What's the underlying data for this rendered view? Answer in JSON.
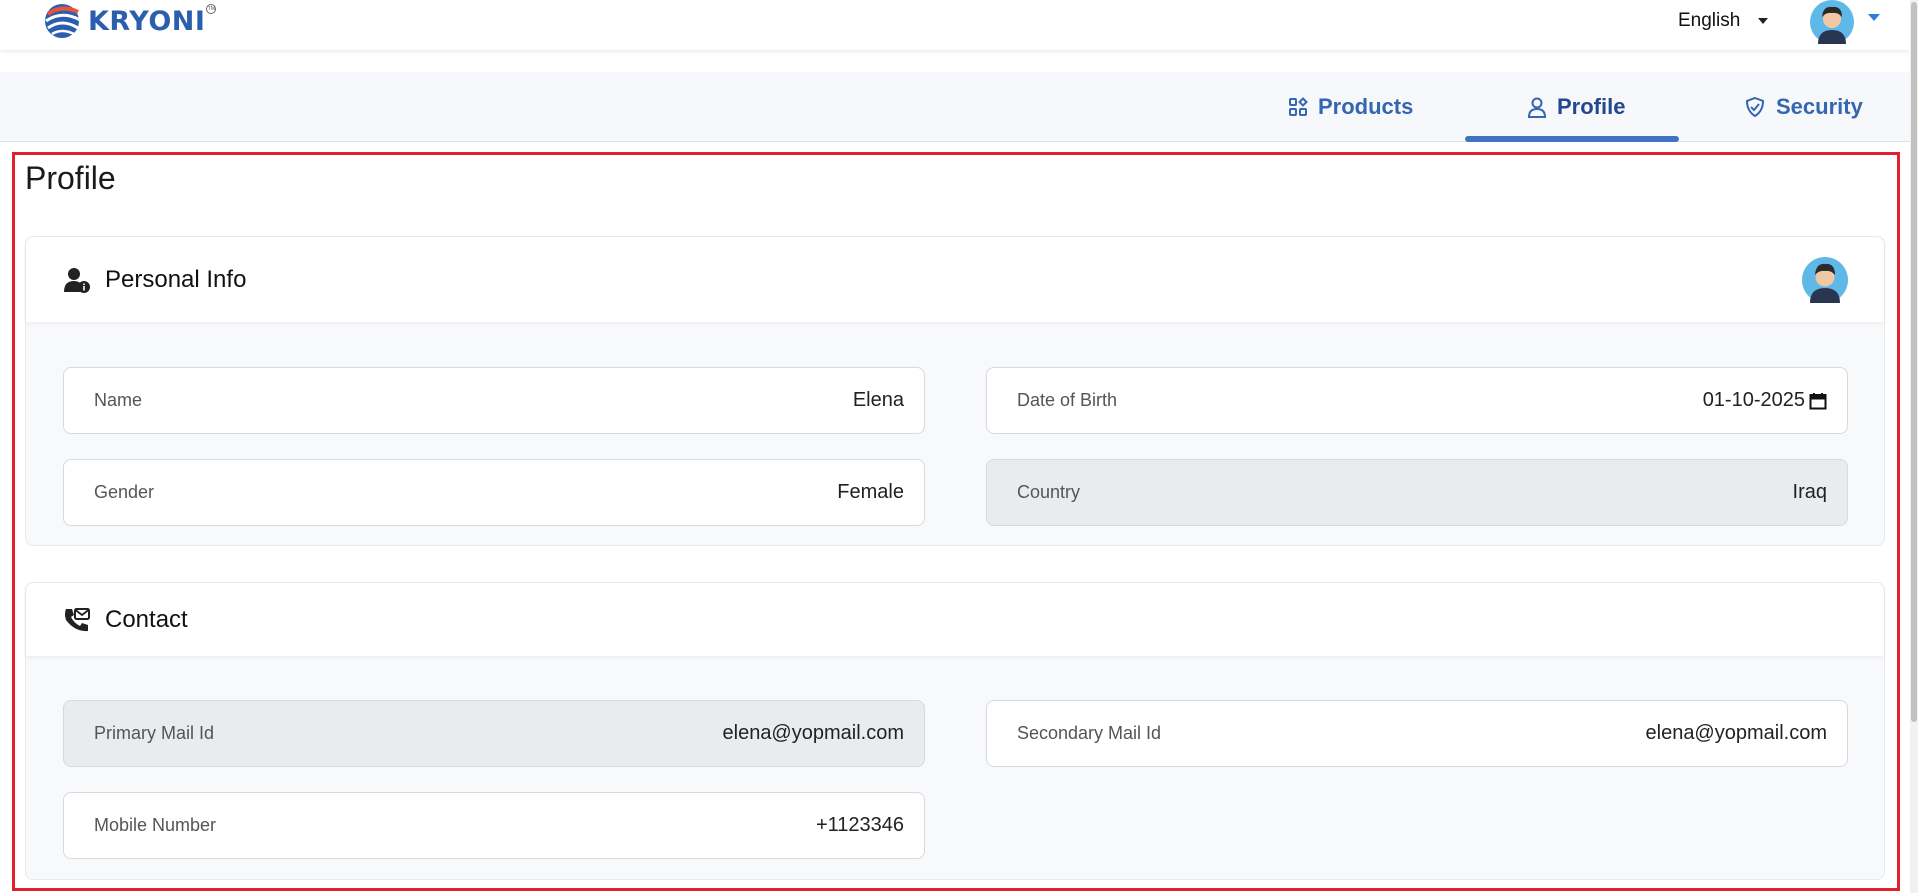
{
  "header": {
    "brand": "KRYONI",
    "brand_mark": "TM",
    "language": "English"
  },
  "tabs": [
    {
      "label": "Products",
      "icon": "grid-icon"
    },
    {
      "label": "Profile",
      "icon": "user-icon",
      "active": true
    },
    {
      "label": "Security",
      "icon": "shield-check-icon"
    }
  ],
  "page": {
    "title": "Profile"
  },
  "personal_info": {
    "title": "Personal Info",
    "name_label": "Name",
    "name_value": "Elena",
    "dob_label": "Date of Birth",
    "dob_value": "01-10-2025",
    "gender_label": "Gender",
    "gender_value": "Female",
    "country_label": "Country",
    "country_value": "Iraq"
  },
  "contact": {
    "title": "Contact",
    "primary_mail_label": "Primary Mail Id",
    "primary_mail_value": "elena@yopmail.com",
    "secondary_mail_label": "Secondary Mail Id",
    "secondary_mail_value": "elena@yopmail.com",
    "mobile_label": "Mobile Number",
    "mobile_value": "+1123346"
  },
  "colors": {
    "brand": "#2c5eae",
    "tab_active": "#23488f",
    "tab_indicator": "#3f74c2",
    "highlight_border": "#e0202c"
  }
}
